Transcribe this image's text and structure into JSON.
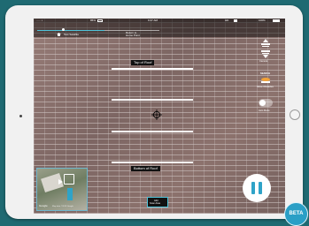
{
  "status_bar": {
    "left_signal": "····· •",
    "drone_battery": "85%",
    "time": "9:47 AM",
    "hd_label": "HD",
    "tablet_battery": "100%"
  },
  "top_bar": {
    "progress": 0.55,
    "left_label": "Test Satellite",
    "right_label_line1": "Return to",
    "right_label_line2": "Home Point"
  },
  "scan": {
    "top_label": "Top of Roof",
    "bottom_label": "Bottom of Roof",
    "center_button_line1": "Add",
    "center_button_line2": "Scan Area"
  },
  "side_panel": {
    "camera_label": "Camera",
    "photo_label": "Photo",
    "auto_label": "SEARCH",
    "overlay_label": "Show Obstacles",
    "toggle_label": "Auto Mode",
    "toggle_on": true
  },
  "minimap": {
    "watermark": "Google",
    "caption": "Map data ©2018 Google"
  },
  "badge": {
    "text": "BETA"
  },
  "colors": {
    "accent": "#2fa3c8",
    "background": "#1f6a72",
    "bezel": "#f1f1f1"
  }
}
